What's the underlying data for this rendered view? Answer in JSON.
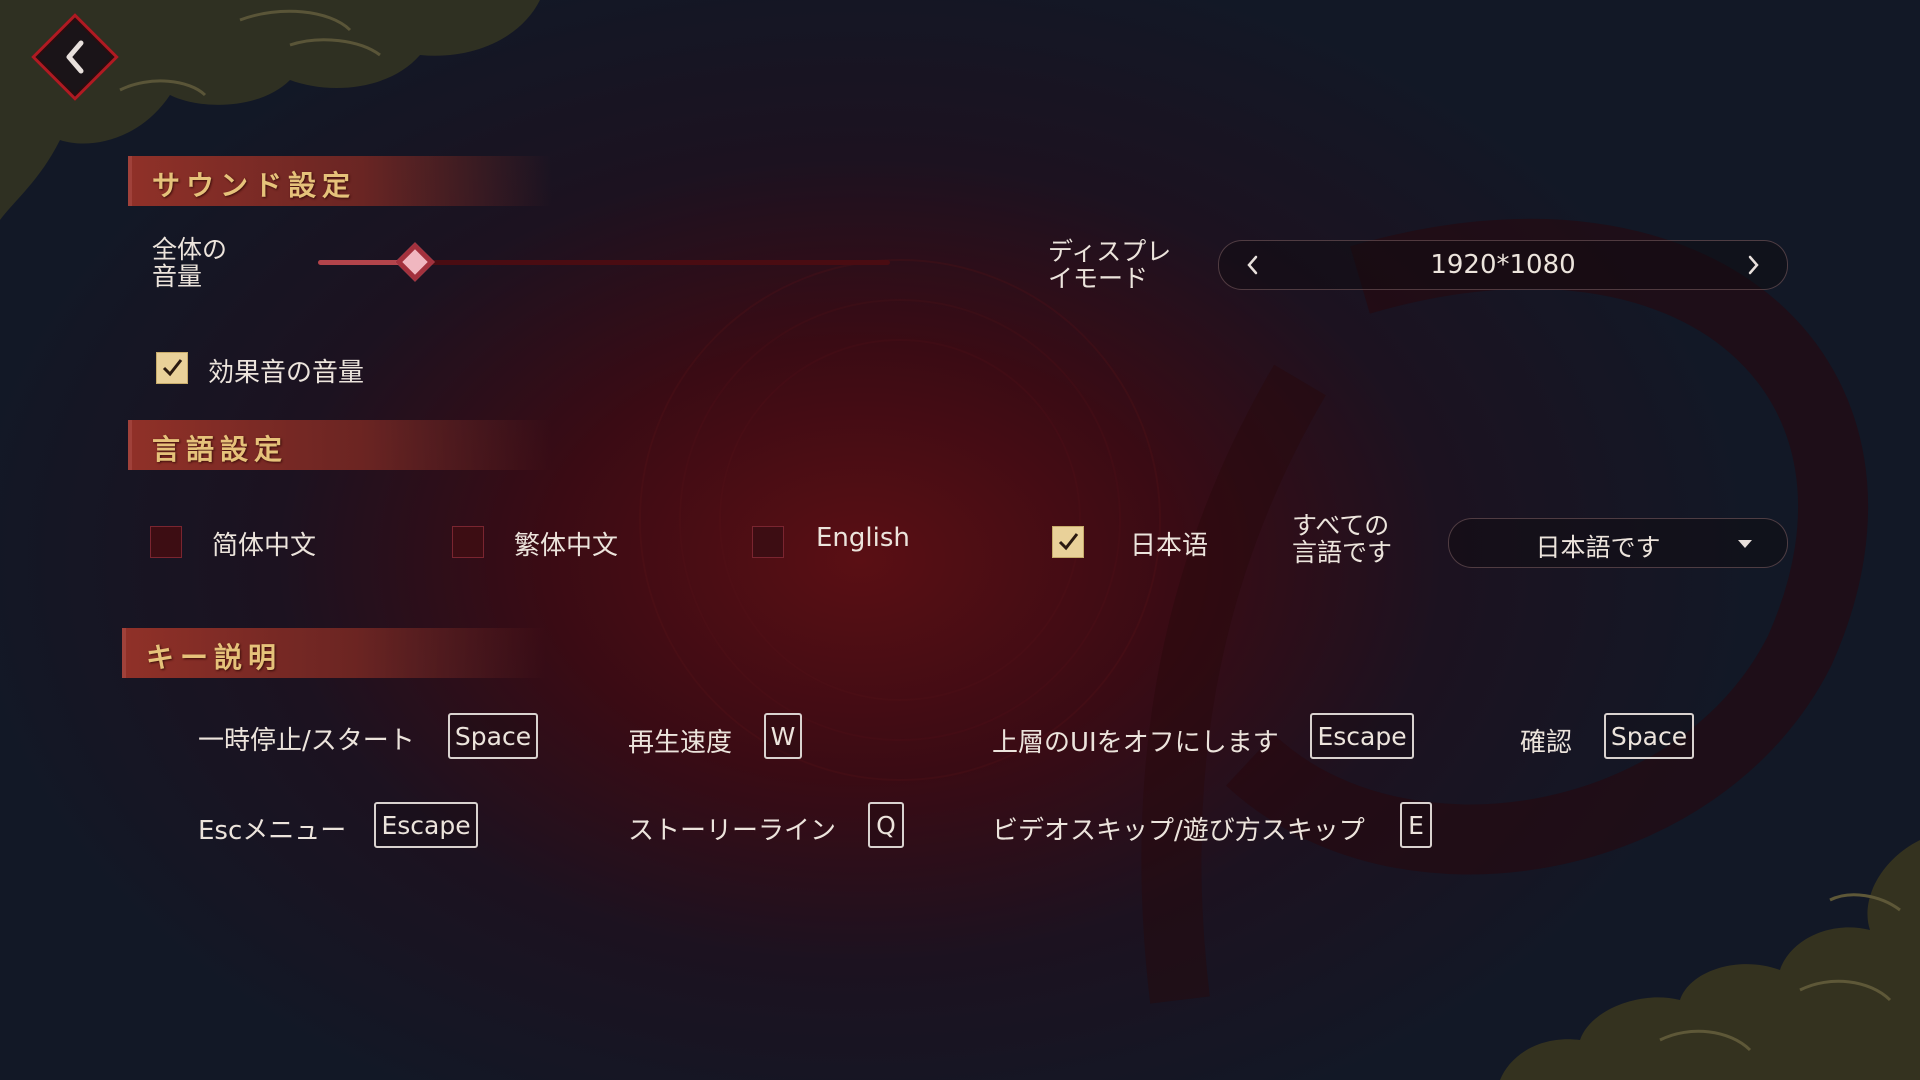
{
  "sections": {
    "sound": "サウンド設定",
    "language": "言語設定",
    "keys": "キー説明"
  },
  "sound": {
    "master_volume_label_line1": "全体の",
    "master_volume_label_line2": "音量",
    "master_volume_level_percent": 17,
    "sfx_label": "効果音の音量",
    "sfx_checked": true
  },
  "display": {
    "label_line1": "ディスプレ",
    "label_line2": "イモード",
    "value": "1920*1080"
  },
  "language": {
    "options": [
      {
        "label": "简体中文",
        "checked": false
      },
      {
        "label": "繁体中文",
        "checked": false
      },
      {
        "label": "English",
        "checked": false
      },
      {
        "label": "日本语",
        "checked": true
      }
    ],
    "all_label_line1": "すべての",
    "all_label_line2": "言語です",
    "dropdown_value": "日本語です"
  },
  "keys": {
    "pause": {
      "label": "一時停止/スタート",
      "key": "Space"
    },
    "speed": {
      "label": "再生速度",
      "key": "W"
    },
    "hide_ui": {
      "label": "上層のUIをオフにします",
      "key": "Escape"
    },
    "confirm": {
      "label": "確認",
      "key": "Space"
    },
    "esc_menu": {
      "label": "Escメニュー",
      "key": "Escape"
    },
    "storyline": {
      "label": "ストーリーライン",
      "key": "Q"
    },
    "skip": {
      "label": "ビデオスキップ/遊び方スキップ",
      "key": "E"
    }
  },
  "icons": {
    "back": "chevron-left-icon",
    "prev": "chevron-left-icon",
    "next": "chevron-right-icon",
    "dropdown": "caret-down-icon",
    "check": "check-icon"
  },
  "colors": {
    "accent_red": "#b01a22",
    "header_gold": "#e6c27a",
    "check_gold": "#e9d199"
  }
}
